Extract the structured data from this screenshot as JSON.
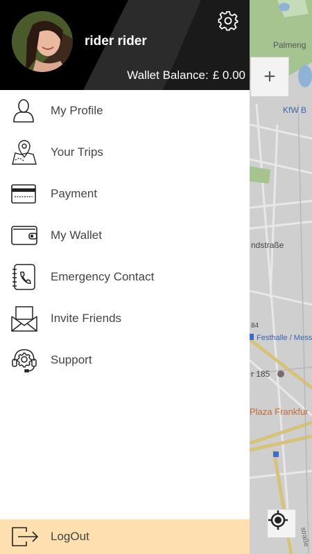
{
  "header": {
    "user_name": "rider rider",
    "wallet_label": "Wallet Balance:",
    "wallet_value": "£ 0.00"
  },
  "menu": {
    "items": [
      {
        "label": "My Profile",
        "icon": "user-icon"
      },
      {
        "label": "Your Trips",
        "icon": "map-pin-icon"
      },
      {
        "label": "Payment",
        "icon": "credit-card-icon"
      },
      {
        "label": "My Wallet",
        "icon": "wallet-icon"
      },
      {
        "label": "Emergency Contact",
        "icon": "phone-book-icon"
      },
      {
        "label": "Invite Friends",
        "icon": "envelope-icon"
      },
      {
        "label": "Support",
        "icon": "headset-gear-icon"
      }
    ],
    "logout_label": "LogOut"
  },
  "map": {
    "labels": {
      "palmeng": "Palmeng",
      "kfw": "KfW B",
      "ndstrasse": "ndstraße",
      "num84": "84",
      "festhalle": "Festhalle / Mess",
      "r185": "r 185",
      "plaza": "Plaza Frankfur",
      "strasse": "straße"
    },
    "zoom_in": "+"
  },
  "colors": {
    "header_bg": "#000000",
    "logout_bg": "#fddfb0",
    "text": "#444444"
  }
}
